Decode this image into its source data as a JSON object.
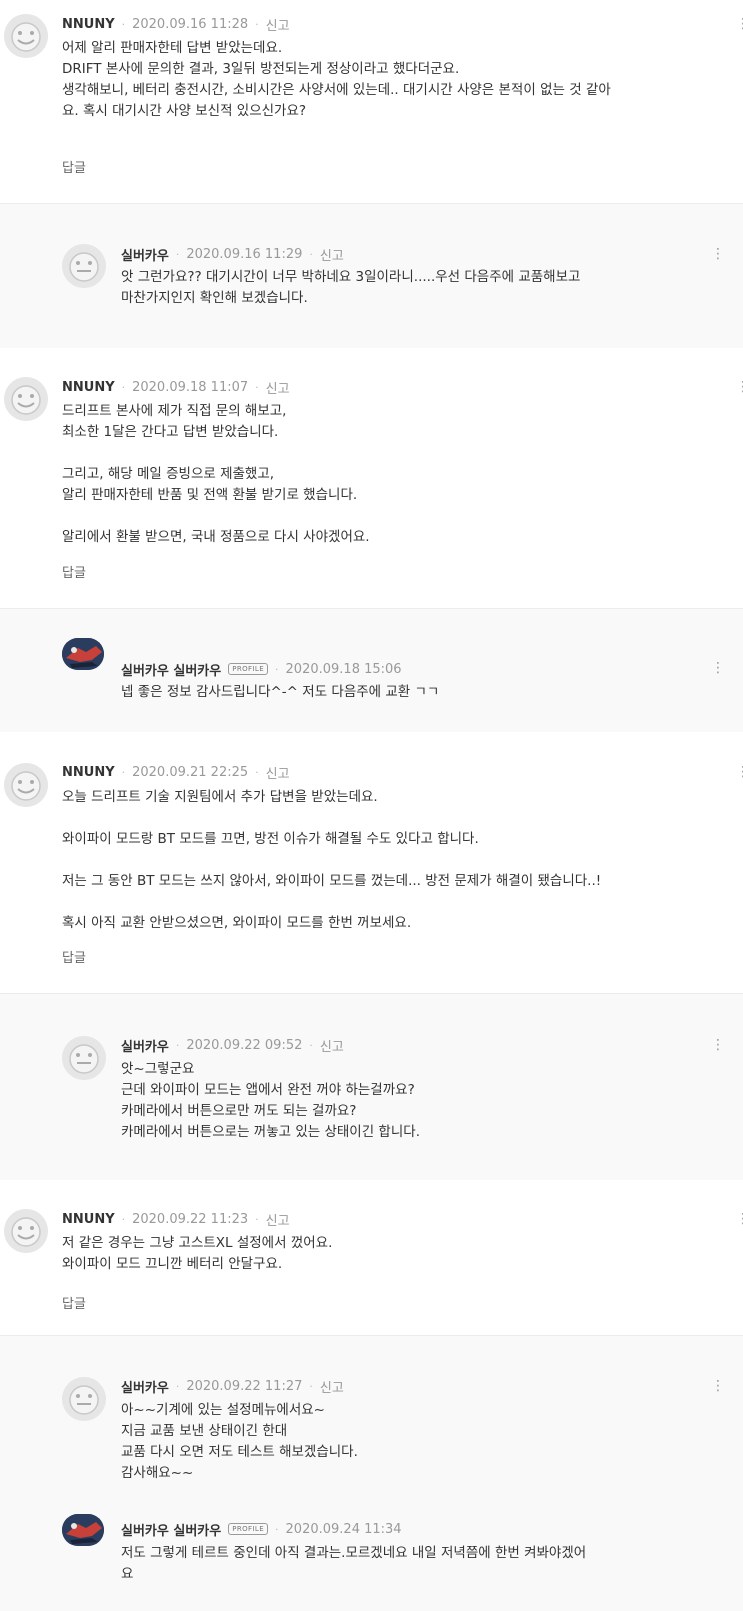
{
  "threads": [
    {
      "top": {
        "nick": "NNUNY",
        "date": "2020.09.16 11:28",
        "report": "신고",
        "body": "어제 알리 판매자한테 답변 받았는데요.\nDRIFT 본사에 문의한 결과, 3일뒤 방전되는게 정상이라고 했다더군요.\n생각해보니, 베터리 충전시간, 소비시간은 사양서에 있는데.. 대기시간 사양은 본적이 없는 것 같아\n요. 혹시 대기시간 사양 보신적 있으신가요?",
        "reply_label": "답글"
      },
      "replies": [
        {
          "nick": "실버카우",
          "date": "2020.09.16 11:29",
          "report": "신고",
          "body": "앗 그런가요?? 대기시간이 너무 박하네요 3일이라니.....우선 다음주에 교품해보고\n마찬가지인지 확인해 보겠습니다."
        }
      ]
    },
    {
      "top": {
        "nick": "NNUNY",
        "date": "2020.09.18 11:07",
        "report": "신고",
        "body": "드리프트 본사에 제가 직접 문의 해보고,\n최소한 1달은 간다고 답변 받았습니다.\n\n그리고, 해당 메일 증빙으로 제출했고,\n알리 판매자한테 반품 및 전액 환불 받기로 했습니다.\n\n알리에서 환불 받으면, 국내 정품으로 다시 사야겠어요.",
        "reply_label": "답글"
      },
      "replies": [
        {
          "nick": "실버카우 실버카우",
          "badge": "PROFILE",
          "date": "2020.09.18 15:06",
          "body": "넵 좋은 정보 감사드립니다^-^ 저도 다음주에 교환 ㄱㄱ"
        }
      ]
    },
    {
      "top": {
        "nick": "NNUNY",
        "date": "2020.09.21 22:25",
        "report": "신고",
        "body": "오늘 드리프트 기술 지원팀에서 추가 답변을 받았는데요.\n\n와이파이 모드랑 BT 모드를 끄면, 방전 이슈가 해결될 수도 있다고 합니다.\n\n저는 그 동안 BT 모드는 쓰지 않아서, 와이파이 모드를 껐는데... 방전 문제가 해결이 됐습니다..!\n\n혹시 아직 교환 안받으셨으면, 와이파이 모드를 한번 꺼보세요.",
        "reply_label": "답글"
      },
      "replies": [
        {
          "nick": "실버카우",
          "date": "2020.09.22 09:52",
          "report": "신고",
          "body": "앗~그렇군요\n근데 와이파이 모드는 앱에서 완전 꺼야 하는걸까요?\n카메라에서 버튼으로만 꺼도 되는 걸까요?\n카메라에서 버튼으로는 꺼놓고 있는 상태이긴 합니다."
        }
      ]
    },
    {
      "top": {
        "nick": "NNUNY",
        "date": "2020.09.22 11:23",
        "report": "신고",
        "body": "저 같은 경우는 그냥 고스트XL 설정에서 껐어요.\n와이파이 모드 끄니깐 베터리 안달구요.",
        "reply_label": "답글"
      },
      "replies": [
        {
          "nick": "실버카우",
          "date": "2020.09.22 11:27",
          "report": "신고",
          "body": "아~~기계에 있는 설정메뉴에서요~\n지금 교품 보낸 상태이긴 한대\n교품 다시 오면 저도 테스트 해보겠습니다.\n감사해요~~"
        },
        {
          "nick": "실버카우 실버카우",
          "badge": "PROFILE",
          "date": "2020.09.24 11:34",
          "body": "저도 그렇게 테르트 중인데 아직 결과는.모르겠네요 내일 저녁쯤에 한번 켜봐야겠어\n요"
        }
      ]
    }
  ],
  "icons": {
    "more": "more-vertical-icon",
    "avatar_default": "smiley-avatar-icon",
    "avatar_photo": "profile-photo-avatar"
  }
}
